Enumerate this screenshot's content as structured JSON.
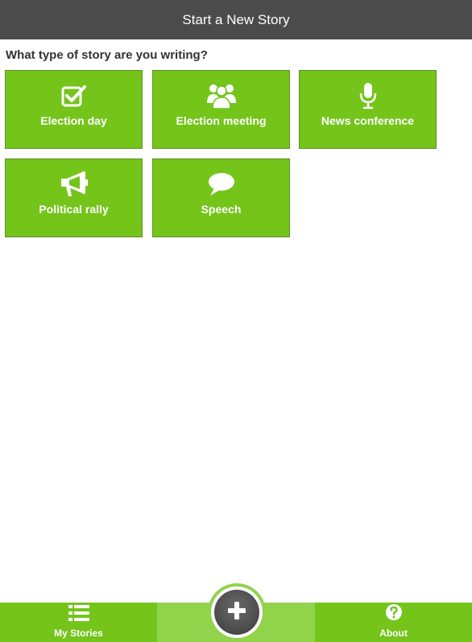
{
  "header": {
    "title": "Start a New Story"
  },
  "question": "What type of story are you writing?",
  "story_types": [
    {
      "label": "Election day",
      "icon": "checkbox-icon"
    },
    {
      "label": "Election meeting",
      "icon": "group-icon"
    },
    {
      "label": "News conference",
      "icon": "microphone-icon"
    },
    {
      "label": "Political rally",
      "icon": "megaphone-icon"
    },
    {
      "label": "Speech",
      "icon": "speech-bubble-icon"
    }
  ],
  "bottom_nav": {
    "my_stories": {
      "label": "My Stories",
      "icon": "list-icon"
    },
    "new_story": {
      "icon": "plus-icon"
    },
    "about": {
      "label": "About",
      "icon": "question-icon"
    }
  },
  "colors": {
    "header_bg": "#4b4b4b",
    "accent_green": "#74c41a",
    "active_tab_green": "#91d34a"
  }
}
